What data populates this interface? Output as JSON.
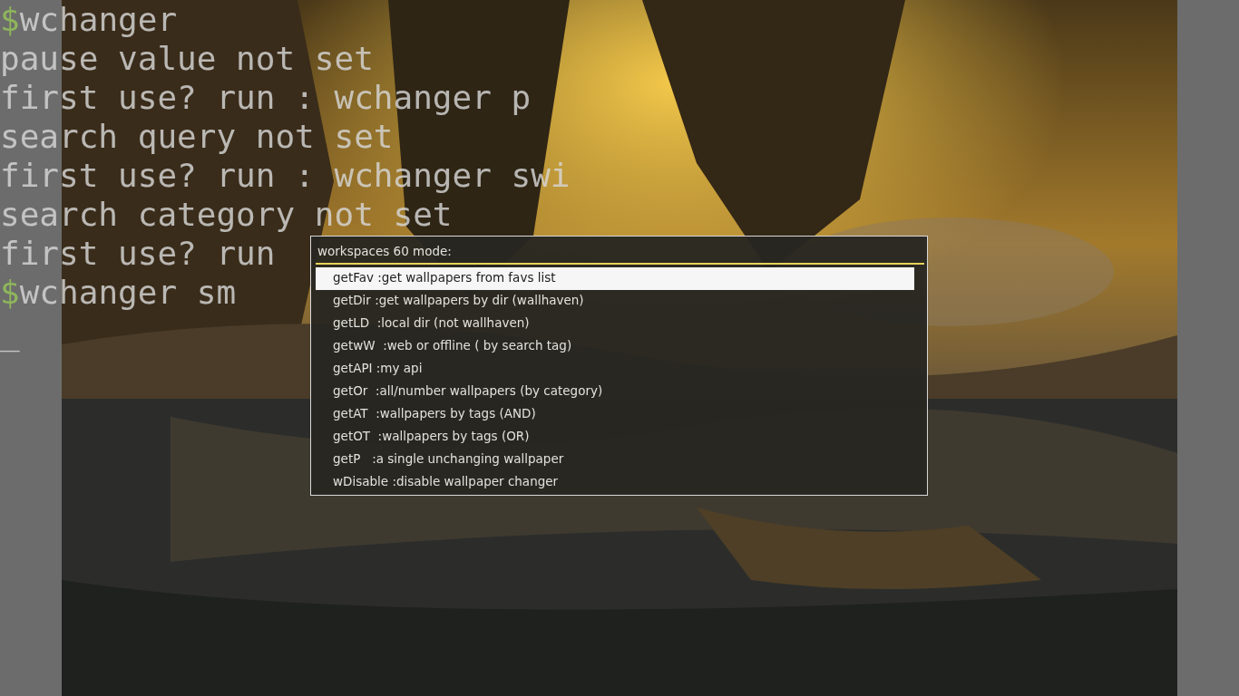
{
  "terminal": {
    "lines": [
      {
        "kind": "prompt",
        "prompt": "$",
        "text": "wchanger"
      },
      {
        "kind": "output",
        "text": "pause value not set"
      },
      {
        "kind": "output",
        "text": "first use? run : wchanger p"
      },
      {
        "kind": "output",
        "text": "search query not set"
      },
      {
        "kind": "output",
        "text": "first use? run : wchanger swi"
      },
      {
        "kind": "output",
        "text": "search category not set"
      },
      {
        "kind": "output",
        "text": "first use? run"
      },
      {
        "kind": "prompt",
        "prompt": "$",
        "text": "wchanger sm"
      }
    ],
    "cursor": "_"
  },
  "menu": {
    "title": "workspaces 60 mode:",
    "items": [
      {
        "label": "getFav :get wallpapers from favs list",
        "selected": true
      },
      {
        "label": "getDir :get wallpapers by dir (wallhaven)",
        "selected": false
      },
      {
        "label": "getLD  :local dir (not wallhaven)",
        "selected": false
      },
      {
        "label": "getwW  :web or offline ( by search tag)",
        "selected": false
      },
      {
        "label": "getAPI :my api",
        "selected": false
      },
      {
        "label": "getOr  :all/number wallpapers (by category)",
        "selected": false
      },
      {
        "label": "getAT  :wallpapers by tags (AND)",
        "selected": false
      },
      {
        "label": "getOT  :wallpapers by tags (OR)",
        "selected": false
      },
      {
        "label": "getP   :a single unchanging wallpaper",
        "selected": false
      },
      {
        "label": "wDisable :disable wallpaper changer",
        "selected": false
      }
    ]
  }
}
